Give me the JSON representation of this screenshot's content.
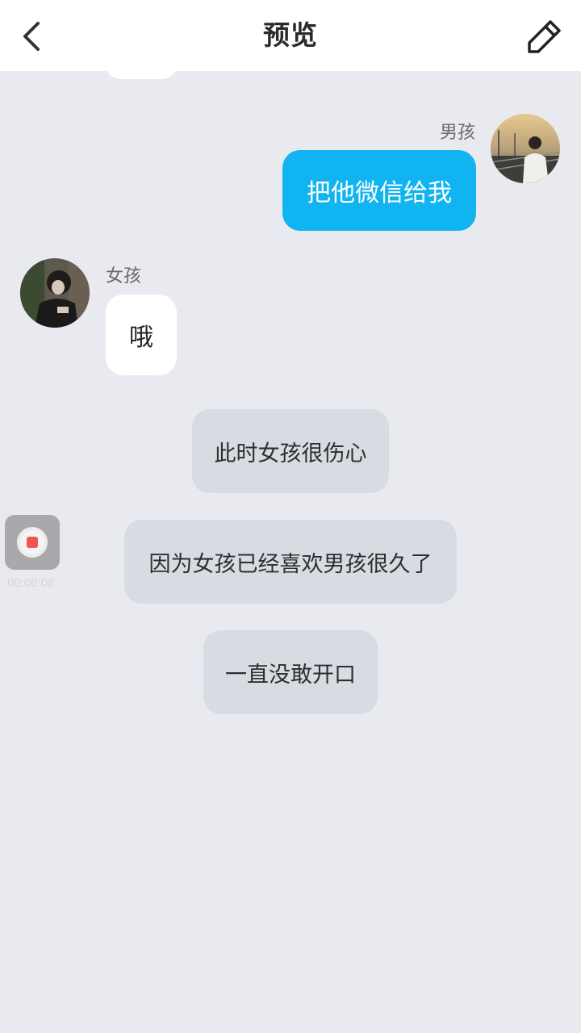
{
  "header": {
    "title": "预览",
    "back_icon": "chevron-left-icon",
    "edit_icon": "pencil-icon"
  },
  "messages": [
    {
      "side": "right",
      "sender": "男孩",
      "text": "把他微信给我",
      "bubble_color": "#10b4f0"
    },
    {
      "side": "left",
      "sender": "女孩",
      "text": "哦",
      "bubble_color": "#ffffff"
    }
  ],
  "narrations": [
    "此时女孩很伤心",
    "因为女孩已经喜欢男孩很久了",
    "一直没敢开口"
  ],
  "recorder": {
    "icon": "record-icon",
    "time": "00:00:08",
    "dot_color": "#f05454"
  },
  "colors": {
    "background": "#e9eaf0",
    "header_bg": "#ffffff",
    "narration_bg": "#d9dbe3"
  }
}
